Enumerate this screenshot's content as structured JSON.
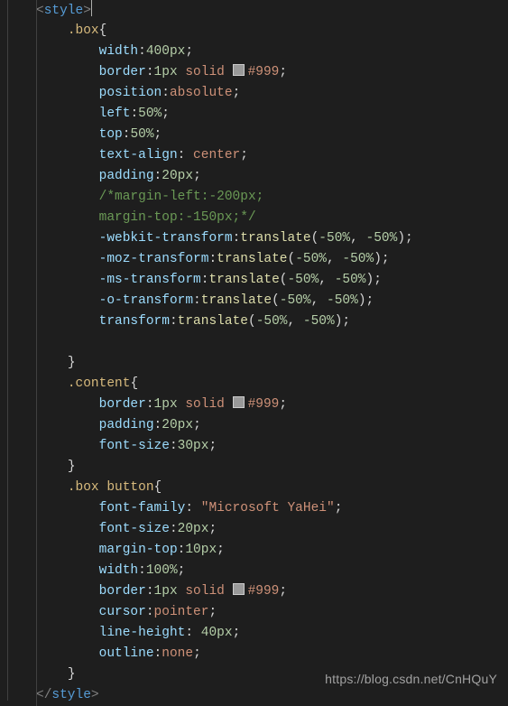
{
  "code": {
    "openTag": "<style>",
    "closeTag": "</style>",
    "rules": [
      {
        "selector": ".box",
        "decls": [
          {
            "prop": "width",
            "value": "400px"
          },
          {
            "prop": "border",
            "value_pre": "1px ",
            "value_kw": "solid",
            "swatch": true,
            "value_post": "#999"
          },
          {
            "prop": "position",
            "value_kw": "absolute"
          },
          {
            "prop": "left",
            "value": "50%"
          },
          {
            "prop": "top",
            "value": "50%"
          },
          {
            "prop": "text-align",
            "space": true,
            "value_kw": "center"
          },
          {
            "prop": "padding",
            "value": "20px"
          },
          {
            "comment": "/*margin-left:-200px;"
          },
          {
            "comment": "margin-top:-150px;*/"
          },
          {
            "prop": "-webkit-transform",
            "func": "translate",
            "args": "(-50%, -50%)"
          },
          {
            "prop": "-moz-transform",
            "func": "translate",
            "args": "(-50%, -50%)"
          },
          {
            "prop": "-ms-transform",
            "func": "translate",
            "args": "(-50%, -50%)"
          },
          {
            "prop": "-o-transform",
            "func": "translate",
            "args": "(-50%, -50%)"
          },
          {
            "prop": "transform",
            "func": "translate",
            "args": "(-50%, -50%)"
          }
        ],
        "blankAfter": true
      },
      {
        "selector": ".content",
        "decls": [
          {
            "prop": "border",
            "value_pre": "1px ",
            "value_kw": "solid",
            "swatch": true,
            "value_post": "#999"
          },
          {
            "prop": "padding",
            "value": "20px"
          },
          {
            "prop": "font-size",
            "value": "30px"
          }
        ]
      },
      {
        "selector": ".box button",
        "decls": [
          {
            "prop": "font-family",
            "space": true,
            "value_str": "\"Microsoft YaHei\""
          },
          {
            "prop": "font-size",
            "value": "20px"
          },
          {
            "prop": "margin-top",
            "value": "10px"
          },
          {
            "prop": "width",
            "value": "100%"
          },
          {
            "prop": "border",
            "value_pre": "1px ",
            "value_kw": "solid",
            "swatch": true,
            "value_post": "#999"
          },
          {
            "prop": "cursor",
            "value_kw": "pointer"
          },
          {
            "prop": "line-height",
            "space": true,
            "value": "40px"
          },
          {
            "prop": "outline",
            "value_kw": "none"
          }
        ]
      }
    ]
  },
  "watermark": "https://blog.csdn.net/CnHQuY"
}
